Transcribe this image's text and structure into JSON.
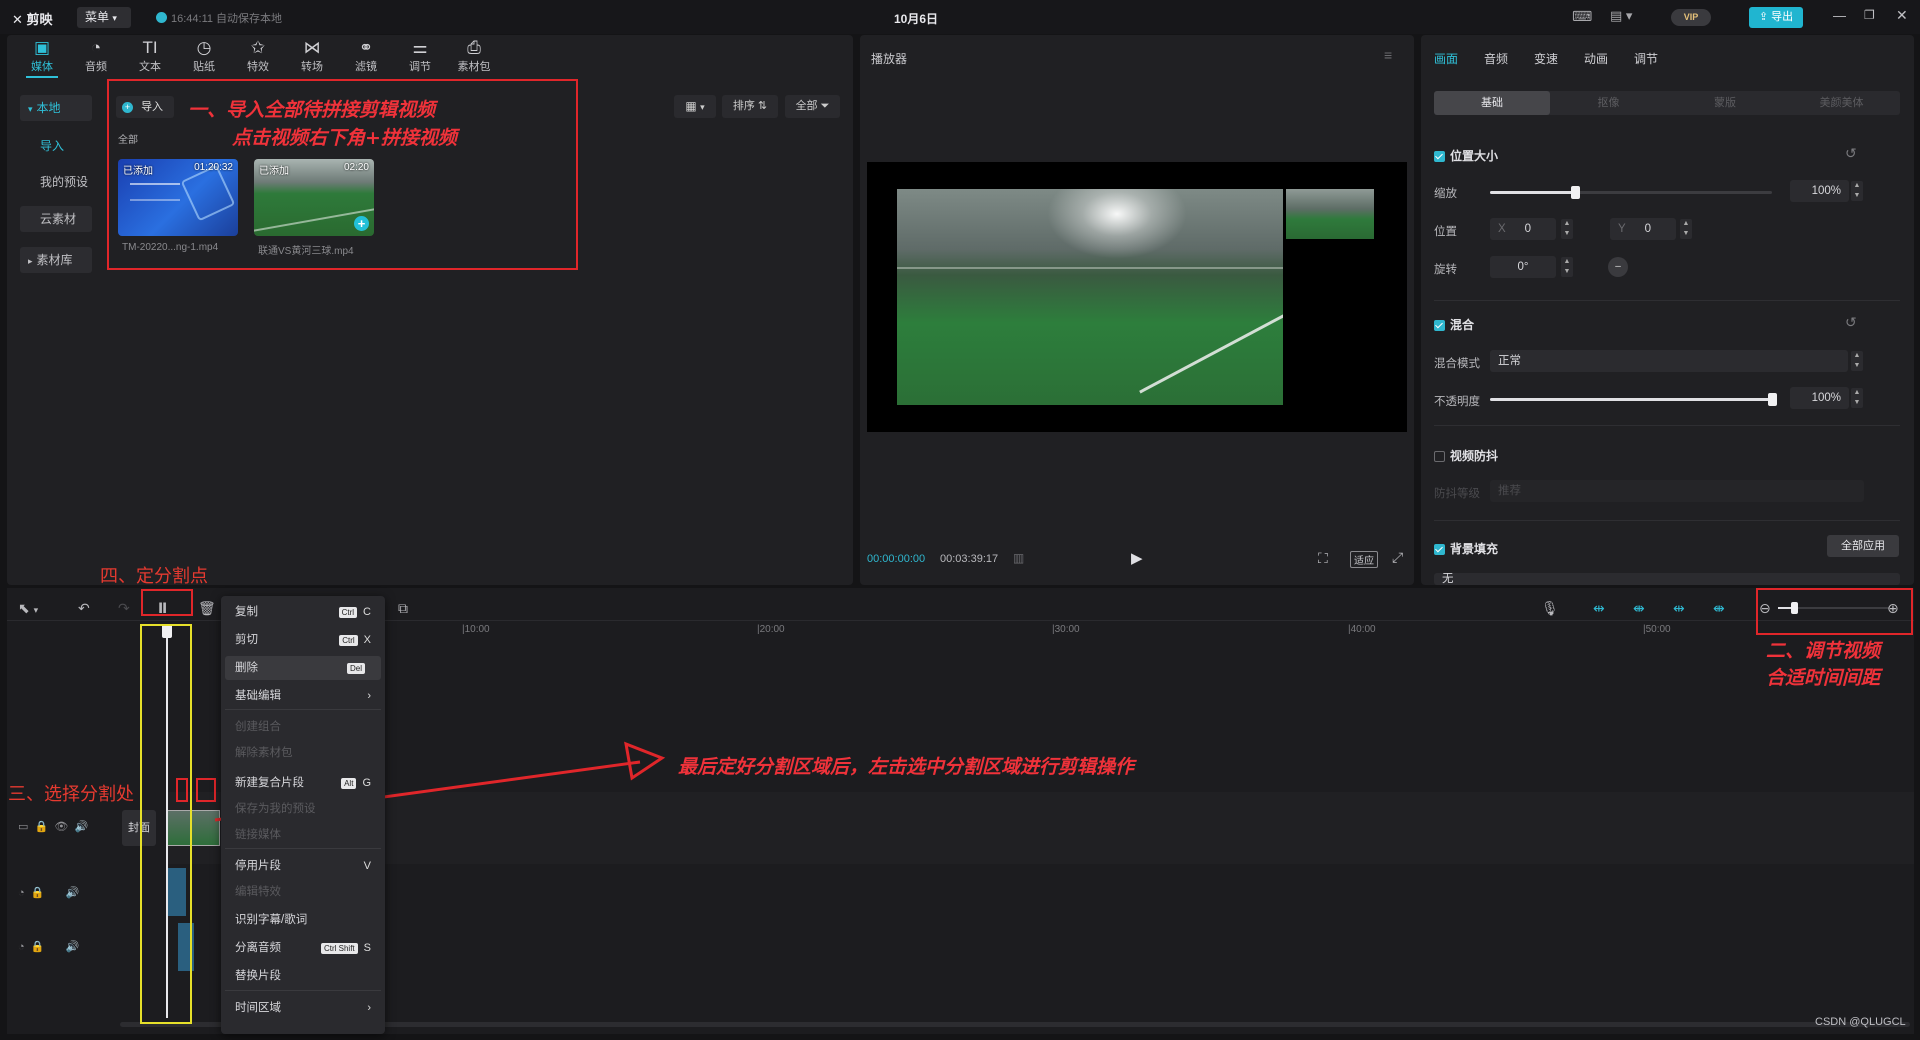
{
  "app": {
    "name": "剪映",
    "menu_label": "菜单",
    "autosave": "16:44:11 自动保存本地",
    "date_title": "10月6日",
    "export_label": "导出",
    "vip_label": "VIP"
  },
  "toolbar": {
    "items": [
      {
        "label": "媒体",
        "icon": "media-icon",
        "glyph": "▣"
      },
      {
        "label": "音频",
        "icon": "audio-icon",
        "glyph": "◔"
      },
      {
        "label": "文本",
        "icon": "text-icon",
        "glyph": "TI"
      },
      {
        "label": "贴纸",
        "icon": "sticker-icon",
        "glyph": "◷"
      },
      {
        "label": "特效",
        "icon": "effects-icon",
        "glyph": "✩"
      },
      {
        "label": "转场",
        "icon": "transition-icon",
        "glyph": "⋈"
      },
      {
        "label": "滤镜",
        "icon": "filter-icon",
        "glyph": "⚭"
      },
      {
        "label": "调节",
        "icon": "adjust-icon",
        "glyph": "⚌"
      },
      {
        "label": "素材包",
        "icon": "asset-pack-icon",
        "glyph": "⎙"
      }
    ]
  },
  "sidebar": {
    "items": [
      {
        "label": "本地",
        "prefix": "▾"
      },
      {
        "label": "导入",
        "prefix": ""
      },
      {
        "label": "我的预设",
        "prefix": ""
      },
      {
        "label": "云素材",
        "prefix": ""
      },
      {
        "label": "素材库",
        "prefix": "▸"
      }
    ]
  },
  "media": {
    "import_label": "导入",
    "sort_label": "排序",
    "filter_label": "全部",
    "all_label": "全部",
    "clips": [
      {
        "badge": "已添加",
        "duration": "01:20:32",
        "name": "TM-20220...ng-1.mp4"
      },
      {
        "badge": "已添加",
        "duration": "02:20",
        "name": "联通VS黄河三球.mp4"
      }
    ]
  },
  "annotations": {
    "step1_line1": "一、导入全部待拼接剪辑视频",
    "step1_line2": "点击视频右下角+拼接视频",
    "step2_line1": "二、调节视频",
    "step2_line2": "合适时间间距",
    "step3": "三、选择分割处",
    "step4": "四、定分割点",
    "final": "最后定好分割区域后，左击选中分割区域进行剪辑操作"
  },
  "player": {
    "title": "播放器",
    "current_time": "00:00:00:00",
    "total_time": "00:03:39:17",
    "ratio_label": "适应"
  },
  "inspector": {
    "tabs": [
      "画面",
      "音频",
      "变速",
      "动画",
      "调节"
    ],
    "subtabs": [
      "基础",
      "抠像",
      "蒙版",
      "美颜美体"
    ],
    "pos_size": {
      "title": "位置大小",
      "scale_label": "缩放",
      "scale_value": "100%",
      "scale_fraction": 0.3,
      "position_label": "位置",
      "x_label": "X",
      "x_value": "0",
      "y_label": "Y",
      "y_value": "0",
      "rotate_label": "旋转",
      "rotate_value": "0°"
    },
    "blend": {
      "title": "混合",
      "mode_label": "混合模式",
      "mode_value": "正常",
      "opacity_label": "不透明度",
      "opacity_value": "100%",
      "opacity_fraction": 1.0
    },
    "stabilize": {
      "title": "视频防抖",
      "level_label": "防抖等级",
      "level_value": "推荐"
    },
    "bg_fill": {
      "title": "背景填充",
      "apply_all": "全部应用",
      "value": "无"
    }
  },
  "timeline": {
    "ruler": [
      "|10:00",
      "|20:00",
      "|30:00",
      "|40:00",
      "|50:00"
    ],
    "cover_label": "封面"
  },
  "context_menu": {
    "items": [
      {
        "label": "复制",
        "kbd": "Ctrl",
        "key": "C",
        "disabled": false
      },
      {
        "label": "剪切",
        "kbd": "Ctrl",
        "key": "X",
        "disabled": false
      },
      {
        "label": "删除",
        "kbd": "Del",
        "key": "",
        "disabled": false
      },
      {
        "label": "基础编辑",
        "kbd": "",
        "key": "›",
        "disabled": false
      },
      {
        "label": "创建组合",
        "kbd": "",
        "key": "",
        "disabled": true
      },
      {
        "label": "解除素材包",
        "kbd": "",
        "key": "",
        "disabled": true
      },
      {
        "label": "新建复合片段",
        "kbd": "Alt",
        "key": "G",
        "disabled": false
      },
      {
        "label": "保存为我的预设",
        "kbd": "",
        "key": "",
        "disabled": true
      },
      {
        "label": "链接媒体",
        "kbd": "",
        "key": "",
        "disabled": true
      },
      {
        "label": "停用片段",
        "kbd": "",
        "key": "V",
        "disabled": false
      },
      {
        "label": "编辑特效",
        "kbd": "",
        "key": "",
        "disabled": true
      },
      {
        "label": "识别字幕/歌词",
        "kbd": "",
        "key": "",
        "disabled": false
      },
      {
        "label": "分离音频",
        "kbd": "Ctrl Shift",
        "key": "S",
        "disabled": false
      },
      {
        "label": "替换片段",
        "kbd": "",
        "key": "",
        "disabled": false
      },
      {
        "label": "时间区域",
        "kbd": "",
        "key": "›",
        "disabled": false
      }
    ]
  },
  "watermark": "CSDN @QLUGCL"
}
